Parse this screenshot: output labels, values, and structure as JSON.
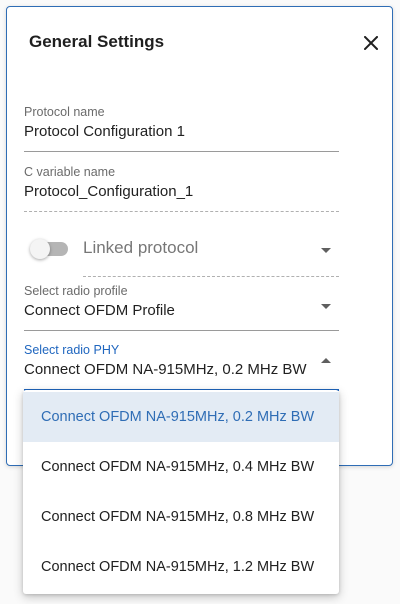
{
  "dialog": {
    "title": "General Settings"
  },
  "fields": {
    "protocol_name": {
      "label": "Protocol name",
      "value": "Protocol Configuration 1"
    },
    "c_variable_name": {
      "label": "C variable name",
      "value": "Protocol_Configuration_1"
    },
    "linked_protocol": {
      "label": "Linked protocol",
      "enabled": false
    },
    "radio_profile": {
      "label": "Select radio profile",
      "value": "Connect OFDM Profile"
    },
    "radio_phy": {
      "label": "Select radio PHY",
      "value": "Connect OFDM NA-915MHz, 0.2 MHz BW"
    }
  },
  "dropdown": {
    "options": [
      {
        "label": "Connect OFDM NA-915MHz, 0.2 MHz BW",
        "selected": true
      },
      {
        "label": "Connect OFDM NA-915MHz, 0.4 MHz BW",
        "selected": false
      },
      {
        "label": "Connect OFDM NA-915MHz, 0.8 MHz BW",
        "selected": false
      },
      {
        "label": "Connect OFDM NA-915MHz, 1.2 MHz BW",
        "selected": false
      }
    ]
  },
  "colors": {
    "accent": "#1f66bf",
    "selected_option_bg": "#e3ebf4",
    "selected_option_text": "#2f6db5"
  },
  "icons": {
    "close": "close-icon",
    "dropdown_arrow": "chevron-down-icon",
    "dropdown_arrow_open": "chevron-up-icon"
  }
}
